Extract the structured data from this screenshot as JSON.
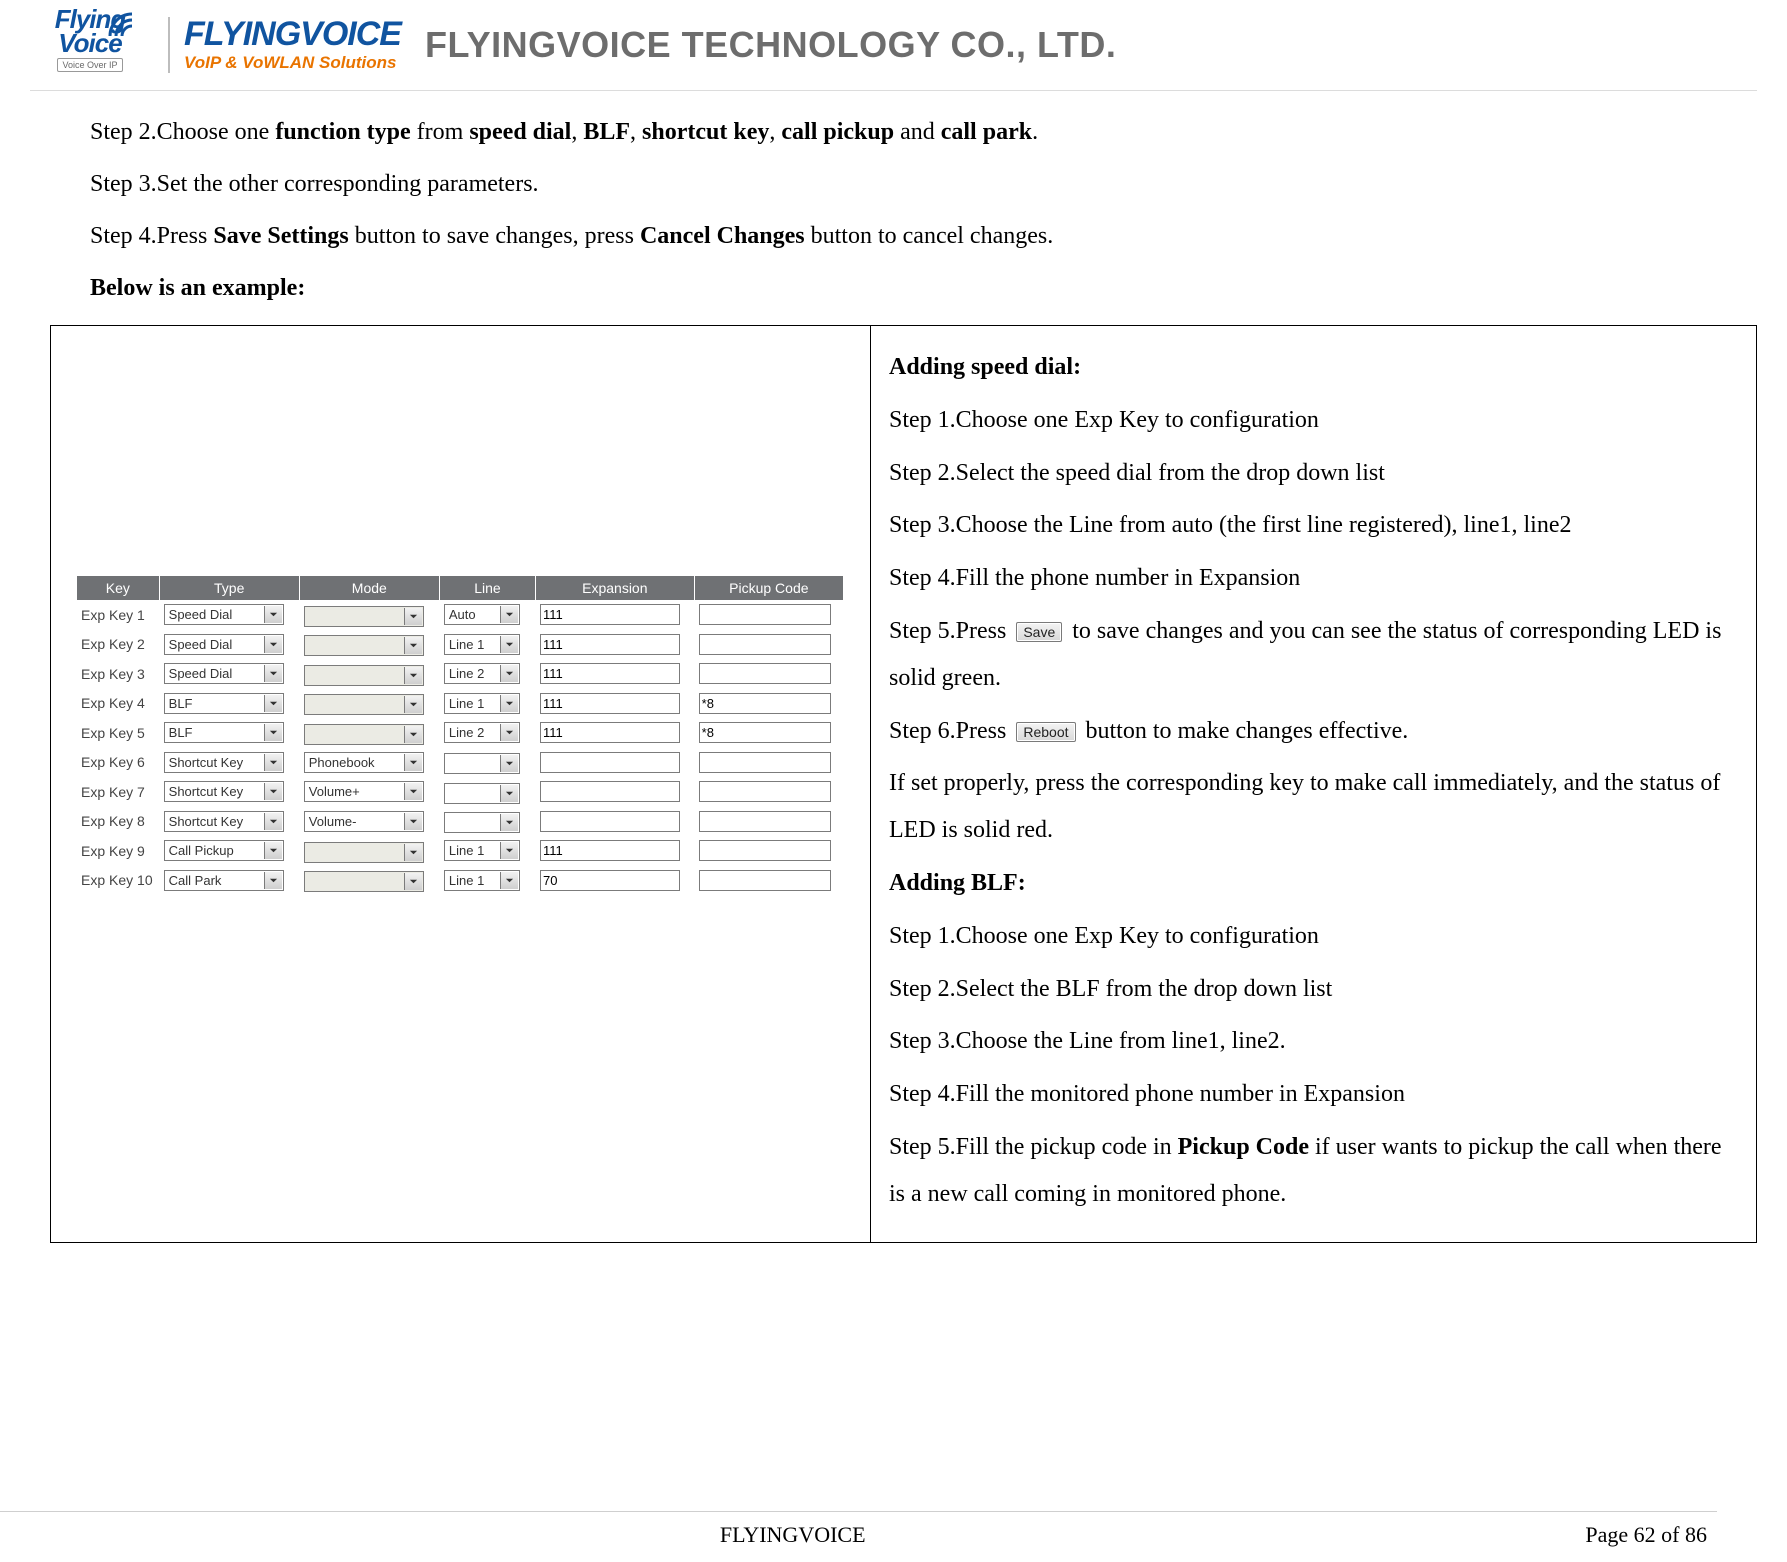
{
  "header": {
    "logo_small_line1": "Flying",
    "logo_small_line2": "Voice",
    "logo_small_sub": "Voice Over IP",
    "logo_big": "FLYINGVOICE",
    "logo_sub": "VoIP & VoWLAN Solutions",
    "company": "FLYINGVOICE TECHNOLOGY CO., LTD."
  },
  "body": {
    "step2_pre": "Step 2.Choose one ",
    "step2_b1": "function type",
    "step2_mid1": " from ",
    "step2_b2": "speed dial",
    "step2_sep": ", ",
    "step2_b3": "BLF",
    "step2_b4": "shortcut key",
    "step2_b5": "call pickup",
    "step2_and": " and ",
    "step2_b6": "call park",
    "step2_end": ".",
    "step3": "Step 3.Set the other corresponding parameters.",
    "step4_pre": "Step 4.Press ",
    "step4_b1": "Save Settings",
    "step4_mid": " button to save changes, press ",
    "step4_b2": "Cancel Changes",
    "step4_end": " button to cancel changes.",
    "below": "Below is an example:"
  },
  "right": {
    "asd_title": "Adding speed dial:",
    "asd_s1": "Step 1.Choose one Exp Key to configuration",
    "asd_s2": "Step 2.Select the speed dial from the drop down list",
    "asd_s3": "Step 3.Choose the Line from auto (the first line registered), line1, line2",
    "asd_s4": "Step 4.Fill the phone number in Expansion",
    "asd_s5_pre": "Step 5.Press ",
    "btn_save": "Save",
    "asd_s5_post": " to save changes and you can see the status of corresponding LED is solid green.",
    "asd_s6_pre": "Step 6.Press ",
    "btn_reboot": "Reboot",
    "asd_s6_post": " button to make changes effective.",
    "asd_note": "If set properly, press the corresponding key to make call immediately, and the status of LED is solid red.",
    "ablf_title": "Adding BLF:",
    "ablf_s1": "Step 1.Choose one Exp Key to configuration",
    "ablf_s2": "Step 2.Select the BLF from the drop down list",
    "ablf_s3": "Step 3.Choose the Line from line1, line2.",
    "ablf_s4": "Step 4.Fill the monitored phone number in Expansion",
    "ablf_s5_pre": "Step 5.Fill the pickup code in ",
    "ablf_s5_b": "Pickup Code",
    "ablf_s5_post": " if user wants to pickup the call when there is a new call coming in monitored phone."
  },
  "table": {
    "headers": {
      "key": "Key",
      "type": "Type",
      "mode": "Mode",
      "line": "Line",
      "exp": "Expansion",
      "pc": "Pickup Code"
    },
    "rows": [
      {
        "key": "Exp Key 1",
        "type": "Speed Dial",
        "mode": "",
        "mode_disabled": true,
        "line": "Auto",
        "exp": "111",
        "pc": ""
      },
      {
        "key": "Exp Key 2",
        "type": "Speed Dial",
        "mode": "",
        "mode_disabled": true,
        "line": "Line 1",
        "exp": "111",
        "pc": ""
      },
      {
        "key": "Exp Key 3",
        "type": "Speed Dial",
        "mode": "",
        "mode_disabled": true,
        "line": "Line 2",
        "exp": "111",
        "pc": ""
      },
      {
        "key": "Exp Key 4",
        "type": "BLF",
        "mode": "",
        "mode_disabled": true,
        "line": "Line 1",
        "exp": "111",
        "pc": "*8"
      },
      {
        "key": "Exp Key 5",
        "type": "BLF",
        "mode": "",
        "mode_disabled": true,
        "line": "Line 2",
        "exp": "111",
        "pc": "*8"
      },
      {
        "key": "Exp Key 6",
        "type": "Shortcut Key",
        "mode": "Phonebook",
        "mode_disabled": false,
        "line": "",
        "line_hidden": true,
        "exp": "",
        "pc": ""
      },
      {
        "key": "Exp Key 7",
        "type": "Shortcut Key",
        "mode": "Volume+",
        "mode_disabled": false,
        "line": "",
        "line_hidden": true,
        "exp": "",
        "pc": ""
      },
      {
        "key": "Exp Key 8",
        "type": "Shortcut Key",
        "mode": "Volume-",
        "mode_disabled": false,
        "line": "",
        "line_hidden": true,
        "exp": "",
        "pc": ""
      },
      {
        "key": "Exp Key 9",
        "type": "Call Pickup",
        "mode": "",
        "mode_disabled": true,
        "line": "Line 1",
        "exp": "111",
        "pc": ""
      },
      {
        "key": "Exp Key 10",
        "type": "Call Park",
        "mode": "",
        "mode_disabled": true,
        "line": "Line 1",
        "exp": "70",
        "pc": ""
      }
    ]
  },
  "footer": {
    "center": "FLYINGVOICE",
    "right_pre": "Page ",
    "right_cur": "62",
    "right_mid": " of ",
    "right_tot": "86"
  }
}
